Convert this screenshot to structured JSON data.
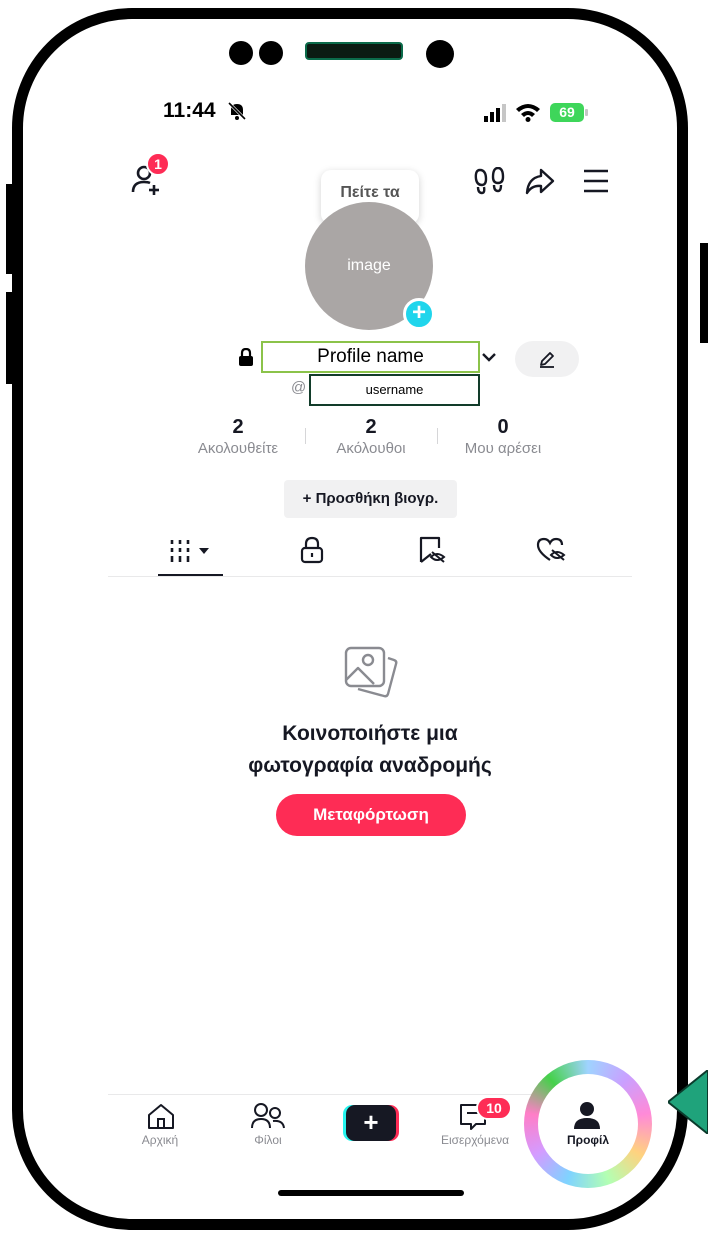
{
  "status_bar": {
    "time": "11:44",
    "battery": "69"
  },
  "header": {
    "add_friend_badge": "1",
    "tooltip": "Πείτε τα"
  },
  "profile": {
    "avatar_placeholder": "image",
    "name": "Profile name",
    "at": "@",
    "username": "username"
  },
  "stats": [
    {
      "value": "2",
      "label": "Ακολουθείτε"
    },
    {
      "value": "2",
      "label": "Ακόλουθοι"
    },
    {
      "value": "0",
      "label": "Μου αρέσει"
    }
  ],
  "bio_button": "+ Προσθήκη βιογρ.",
  "empty_state": {
    "title_line1": "Κοινοποιήστε μια",
    "title_line2": "φωτογραφία αναδρομής",
    "button": "Μεταφόρτωση"
  },
  "nav": {
    "home": "Αρχική",
    "friends": "Φίλοι",
    "inbox": "Εισερχόμενα",
    "inbox_badge": "10",
    "profile": "Προφίλ"
  },
  "colors": {
    "accent": "#fe2c55",
    "plus": "#20d5ec",
    "battery": "#3ed65a"
  }
}
